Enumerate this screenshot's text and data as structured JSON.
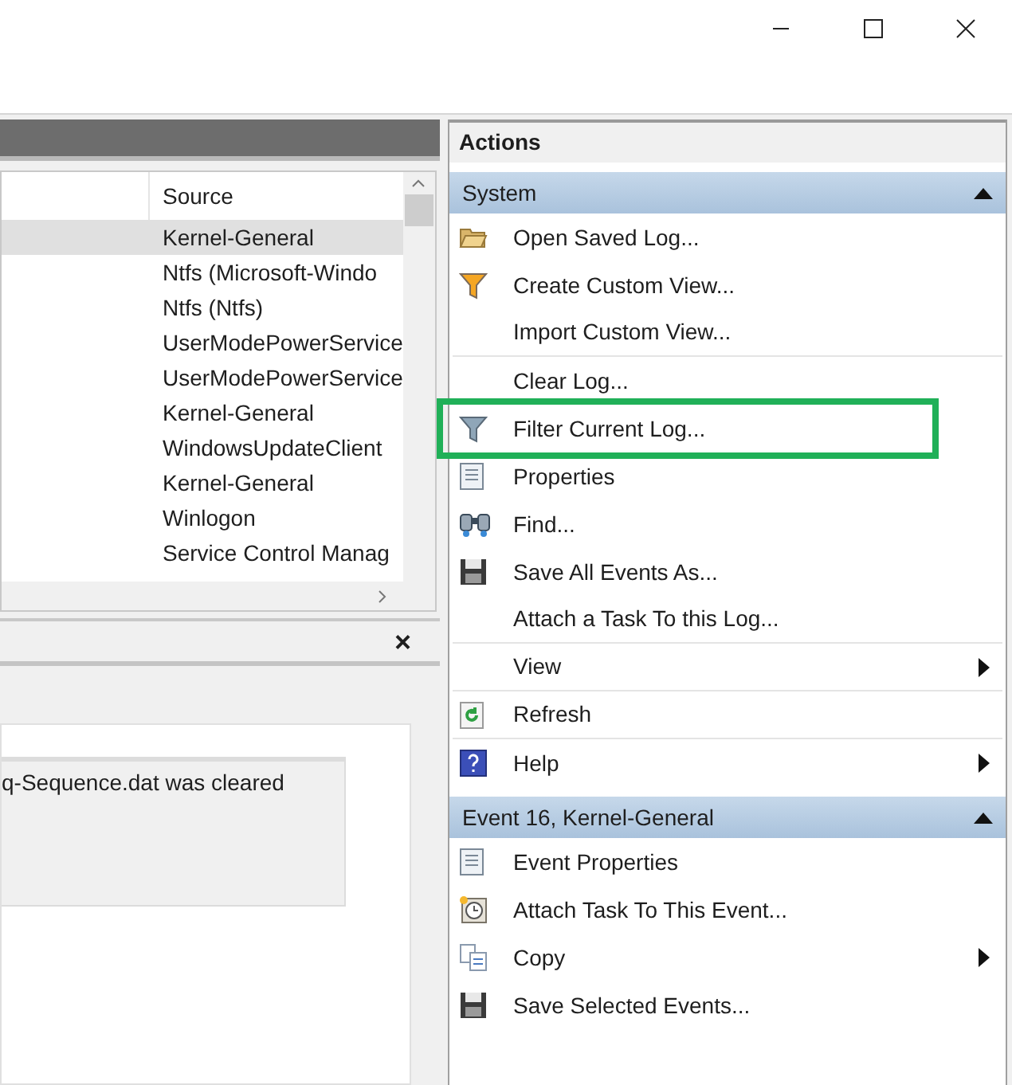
{
  "events_table": {
    "columns": [
      "Source"
    ],
    "rows": [
      {
        "source": "Kernel-General",
        "selected": true
      },
      {
        "source": "Ntfs (Microsoft-Windo",
        "selected": false
      },
      {
        "source": "Ntfs (Ntfs)",
        "selected": false
      },
      {
        "source": "UserModePowerService",
        "selected": false
      },
      {
        "source": "UserModePowerService",
        "selected": false
      },
      {
        "source": "Kernel-General",
        "selected": false
      },
      {
        "source": "WindowsUpdateClient",
        "selected": false
      },
      {
        "source": "Kernel-General",
        "selected": false
      },
      {
        "source": "Winlogon",
        "selected": false
      },
      {
        "source": "Service Control Manag",
        "selected": false
      }
    ]
  },
  "details_pane": {
    "close": "×",
    "message": "q-Sequence.dat was cleared"
  },
  "actions": {
    "title": "Actions",
    "sections": [
      {
        "title": "System",
        "expanded": true,
        "items": [
          {
            "label": "Open Saved Log...",
            "submenu": false,
            "separator_after": false,
            "highlighted": false
          },
          {
            "label": "Create Custom View...",
            "submenu": false,
            "separator_after": false,
            "highlighted": false
          },
          {
            "label": "Import Custom View...",
            "submenu": false,
            "separator_after": true,
            "highlighted": false
          },
          {
            "label": "Clear Log...",
            "submenu": false,
            "separator_after": false,
            "highlighted": false
          },
          {
            "label": "Filter Current Log...",
            "submenu": false,
            "separator_after": false,
            "highlighted": true
          },
          {
            "label": "Properties",
            "submenu": false,
            "separator_after": false,
            "highlighted": false
          },
          {
            "label": "Find...",
            "submenu": false,
            "separator_after": false,
            "highlighted": false
          },
          {
            "label": "Save All Events As...",
            "submenu": false,
            "separator_after": false,
            "highlighted": false
          },
          {
            "label": "Attach a Task To this Log...",
            "submenu": false,
            "separator_after": true,
            "highlighted": false
          },
          {
            "label": "View",
            "submenu": true,
            "separator_after": true,
            "highlighted": false
          },
          {
            "label": "Refresh",
            "submenu": false,
            "separator_after": true,
            "highlighted": false
          },
          {
            "label": "Help",
            "submenu": true,
            "separator_after": false,
            "highlighted": false
          }
        ]
      },
      {
        "title": "Event 16, Kernel-General",
        "expanded": true,
        "items": [
          {
            "label": "Event Properties",
            "submenu": false,
            "separator_after": false,
            "highlighted": false
          },
          {
            "label": "Attach Task To This Event...",
            "submenu": false,
            "separator_after": false,
            "highlighted": false
          },
          {
            "label": "Copy",
            "submenu": true,
            "separator_after": false,
            "highlighted": false
          },
          {
            "label": "Save Selected Events...",
            "submenu": false,
            "separator_after": false,
            "highlighted": false
          }
        ]
      }
    ]
  }
}
